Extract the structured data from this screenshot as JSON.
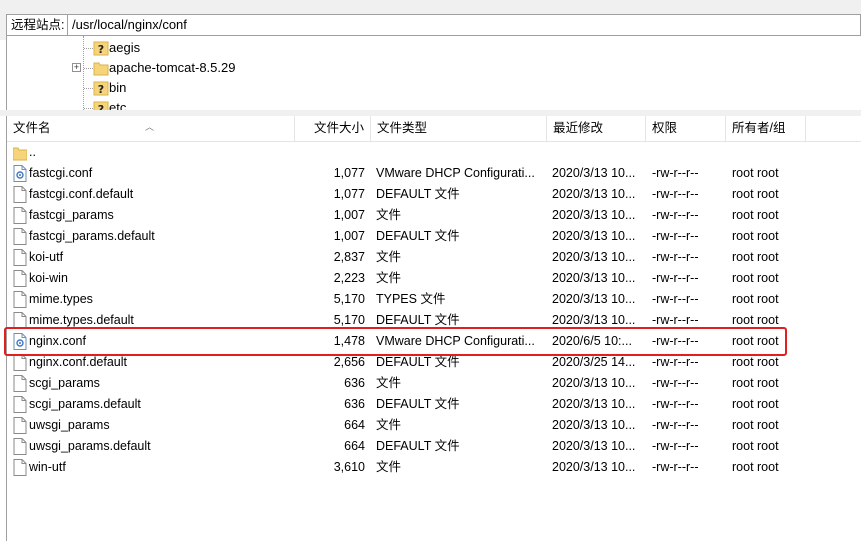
{
  "site_bar": {
    "label": "远程站点:",
    "path": "/usr/local/nginx/conf"
  },
  "tree": [
    {
      "name": "aegis",
      "icon": "unknown-folder-icon",
      "expandable": false
    },
    {
      "name": "apache-tomcat-8.5.29",
      "icon": "folder-icon",
      "expandable": true
    },
    {
      "name": "bin",
      "icon": "unknown-folder-icon",
      "expandable": false
    },
    {
      "name": "etc",
      "icon": "unknown-folder-icon",
      "expandable": false
    }
  ],
  "columns": {
    "name": "文件名",
    "size": "文件大小",
    "type": "文件类型",
    "modified": "最近修改",
    "perm": "权限",
    "owner": "所有者/组"
  },
  "files": [
    {
      "name": "..",
      "size": "",
      "type": "",
      "modified": "",
      "perm": "",
      "owner": "",
      "icon": "folder-icon"
    },
    {
      "name": "fastcgi.conf",
      "size": "1,077",
      "type": "VMware DHCP Configurati...",
      "modified": "2020/3/13 10...",
      "perm": "-rw-r--r--",
      "owner": "root root",
      "icon": "config-file-icon"
    },
    {
      "name": "fastcgi.conf.default",
      "size": "1,077",
      "type": "DEFAULT 文件",
      "modified": "2020/3/13 10...",
      "perm": "-rw-r--r--",
      "owner": "root root",
      "icon": "file-icon"
    },
    {
      "name": "fastcgi_params",
      "size": "1,007",
      "type": "文件",
      "modified": "2020/3/13 10...",
      "perm": "-rw-r--r--",
      "owner": "root root",
      "icon": "file-icon"
    },
    {
      "name": "fastcgi_params.default",
      "size": "1,007",
      "type": "DEFAULT 文件",
      "modified": "2020/3/13 10...",
      "perm": "-rw-r--r--",
      "owner": "root root",
      "icon": "file-icon"
    },
    {
      "name": "koi-utf",
      "size": "2,837",
      "type": "文件",
      "modified": "2020/3/13 10...",
      "perm": "-rw-r--r--",
      "owner": "root root",
      "icon": "file-icon"
    },
    {
      "name": "koi-win",
      "size": "2,223",
      "type": "文件",
      "modified": "2020/3/13 10...",
      "perm": "-rw-r--r--",
      "owner": "root root",
      "icon": "file-icon"
    },
    {
      "name": "mime.types",
      "size": "5,170",
      "type": "TYPES 文件",
      "modified": "2020/3/13 10...",
      "perm": "-rw-r--r--",
      "owner": "root root",
      "icon": "file-icon"
    },
    {
      "name": "mime.types.default",
      "size": "5,170",
      "type": "DEFAULT 文件",
      "modified": "2020/3/13 10...",
      "perm": "-rw-r--r--",
      "owner": "root root",
      "icon": "file-icon"
    },
    {
      "name": "nginx.conf",
      "size": "1,478",
      "type": "VMware DHCP Configurati...",
      "modified": "2020/6/5 10:...",
      "perm": "-rw-r--r--",
      "owner": "root root",
      "icon": "config-file-icon"
    },
    {
      "name": "nginx.conf.default",
      "size": "2,656",
      "type": "DEFAULT 文件",
      "modified": "2020/3/25 14...",
      "perm": "-rw-r--r--",
      "owner": "root root",
      "icon": "file-icon"
    },
    {
      "name": "scgi_params",
      "size": "636",
      "type": "文件",
      "modified": "2020/3/13 10...",
      "perm": "-rw-r--r--",
      "owner": "root root",
      "icon": "file-icon"
    },
    {
      "name": "scgi_params.default",
      "size": "636",
      "type": "DEFAULT 文件",
      "modified": "2020/3/13 10...",
      "perm": "-rw-r--r--",
      "owner": "root root",
      "icon": "file-icon"
    },
    {
      "name": "uwsgi_params",
      "size": "664",
      "type": "文件",
      "modified": "2020/3/13 10...",
      "perm": "-rw-r--r--",
      "owner": "root root",
      "icon": "file-icon"
    },
    {
      "name": "uwsgi_params.default",
      "size": "664",
      "type": "DEFAULT 文件",
      "modified": "2020/3/13 10...",
      "perm": "-rw-r--r--",
      "owner": "root root",
      "icon": "file-icon"
    },
    {
      "name": "win-utf",
      "size": "3,610",
      "type": "文件",
      "modified": "2020/3/13 10...",
      "perm": "-rw-r--r--",
      "owner": "root root",
      "icon": "file-icon"
    }
  ],
  "highlighted_file": "nginx.conf",
  "colors": {
    "highlight_border": "#e02020",
    "folder": "#f6d57a",
    "unknown_folder": "#f6d57a"
  }
}
